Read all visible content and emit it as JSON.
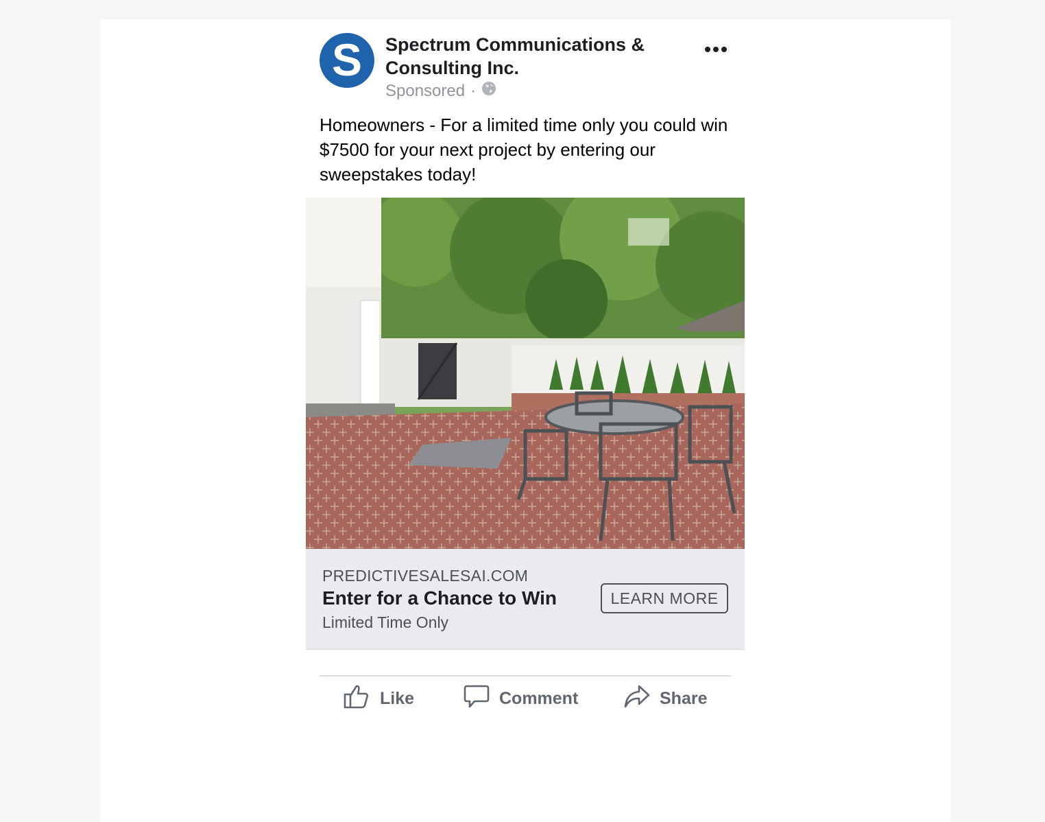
{
  "post": {
    "page_name": "Spectrum Communications & Consulting Inc.",
    "avatar_letter": "S",
    "sponsored": "Sponsored",
    "separator": "·",
    "text": "Homeowners - For a limited time only you could win $7500 for your next project by entering our sweepstakes today!"
  },
  "image": {
    "alt": "Brick patio with metal table and chairs beside white garden wall and trees"
  },
  "link": {
    "domain": "PREDICTIVESALESAI.COM",
    "headline": "Enter for a Chance to Win",
    "description": "Limited Time Only",
    "cta": "LEARN MORE"
  },
  "actions": {
    "like": "Like",
    "comment": "Comment",
    "share": "Share"
  },
  "colors": {
    "brand_blue": "#1f63ad",
    "cta_bar": "#e9ebee",
    "action_gray": "#606770"
  }
}
